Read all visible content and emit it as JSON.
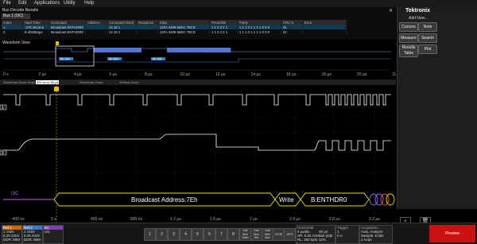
{
  "menu": {
    "items": [
      "File",
      "Edit",
      "Applications",
      "Utility",
      "Help"
    ]
  },
  "brand": {
    "name": "Tektronix",
    "add_new": "Add New..."
  },
  "right_panel": {
    "buttons": [
      "Cursors",
      "Note",
      "Measure",
      "Search",
      "Results Table",
      "Plot"
    ]
  },
  "decode": {
    "title": "Bus Decode Results",
    "tab": "Bus 1 (I3C)",
    "columns": [
      "Index",
      "Start Time",
      "Command",
      "Address",
      "Command Word",
      "Response",
      "Data",
      "Preamble",
      "Parity",
      "CRC-5",
      "Error"
    ],
    "rows": [
      [
        "1",
        "-376.4613ns",
        "Broadcast ENTHDR0",
        "",
        "13 18 1",
        "",
        "12FA 3409 56DC 78CD",
        "1 2 3 3 2 1",
        "1 1 1 0 1 1 1 1 0 0 0",
        "01",
        ""
      ],
      [
        "2",
        "8.403352µs",
        "Broadcast ENTHDR0",
        "",
        "13 18 1",
        "",
        "12FA 3409 56DC 78CD",
        "1 2 3 3 2 1",
        "1 1 1 0 1 1 1 1 0 0 0",
        "02",
        ""
      ]
    ]
  },
  "waveform_view": {
    "title": "Waveform View",
    "markers": [
      "8K 25%",
      "8K 25%",
      "8K 25%"
    ],
    "ticks": [
      "0 s",
      "2 µs",
      "4 µs",
      "6 µs",
      "8 µs",
      "10 µs",
      "12 µs",
      "14 µs",
      "16 µs",
      "18 µs",
      "20 µs",
      "22 µs"
    ]
  },
  "zoom_bar": {
    "label": "Horizontal Zoom Scale",
    "value": "400 ns to 50 ps",
    "labels": [
      "Horizontal Zoom",
      "Vertical Zoom"
    ]
  },
  "plot": {
    "ch1_label": "1",
    "ch2_label": "2",
    "bus_label": "I3C",
    "bus_segments": [
      "Broadcast Address:7Eh",
      "Write",
      "B:ENTHDR0"
    ],
    "xticks": [
      "-400 ns",
      "0 s",
      "400 ns",
      "800 ns",
      "1.2 µs",
      "1.6 µs",
      "2 µs",
      "2.4 µs",
      "2.8 µs",
      "3.2 µs",
      "3.6 µs"
    ]
  },
  "bottom": {
    "ref1": {
      "label": "Ref 1",
      "lines": [
        "1 V/div",
        "6.25 GS/s",
        "DDR: 80M"
      ]
    },
    "ref2": {
      "label": "Ref 2",
      "lines": [
        "1 V/div",
        "6.25 GS/s",
        "DDR: 80M"
      ]
    },
    "bus": {
      "label": "B1",
      "sub": "I3C"
    },
    "numbers": [
      "1",
      "2",
      "3",
      "4",
      "5",
      "6",
      "7",
      "8"
    ],
    "add_buttons": [
      "Add New Math",
      "Add New Ref",
      "Add New Bus",
      "DVM",
      "AFG"
    ],
    "horizontal": {
      "title": "Horizontal",
      "lines": [
        "4 µs/div",
        "SR: 6.25 GS/s",
        "RL: 250 kpts"
      ],
      "right": [
        "40 µs",
        "160 pt/pt",
        "11%"
      ]
    },
    "trigger": {
      "title": "Trigger",
      "lines": [
        "1",
        "0 V"
      ]
    },
    "acquisition": {
      "title": "Acquisition",
      "lines": [
        "Auto, Analyze",
        "Sample: 8 bits",
        "1 Acqs"
      ]
    },
    "preview": "Preview"
  },
  "colors": {
    "bus": "#c060f0",
    "ch": "#ffffff",
    "decode_yellow": "#e6e600",
    "sel": "#0e3a55",
    "preview": "#cc1111"
  }
}
